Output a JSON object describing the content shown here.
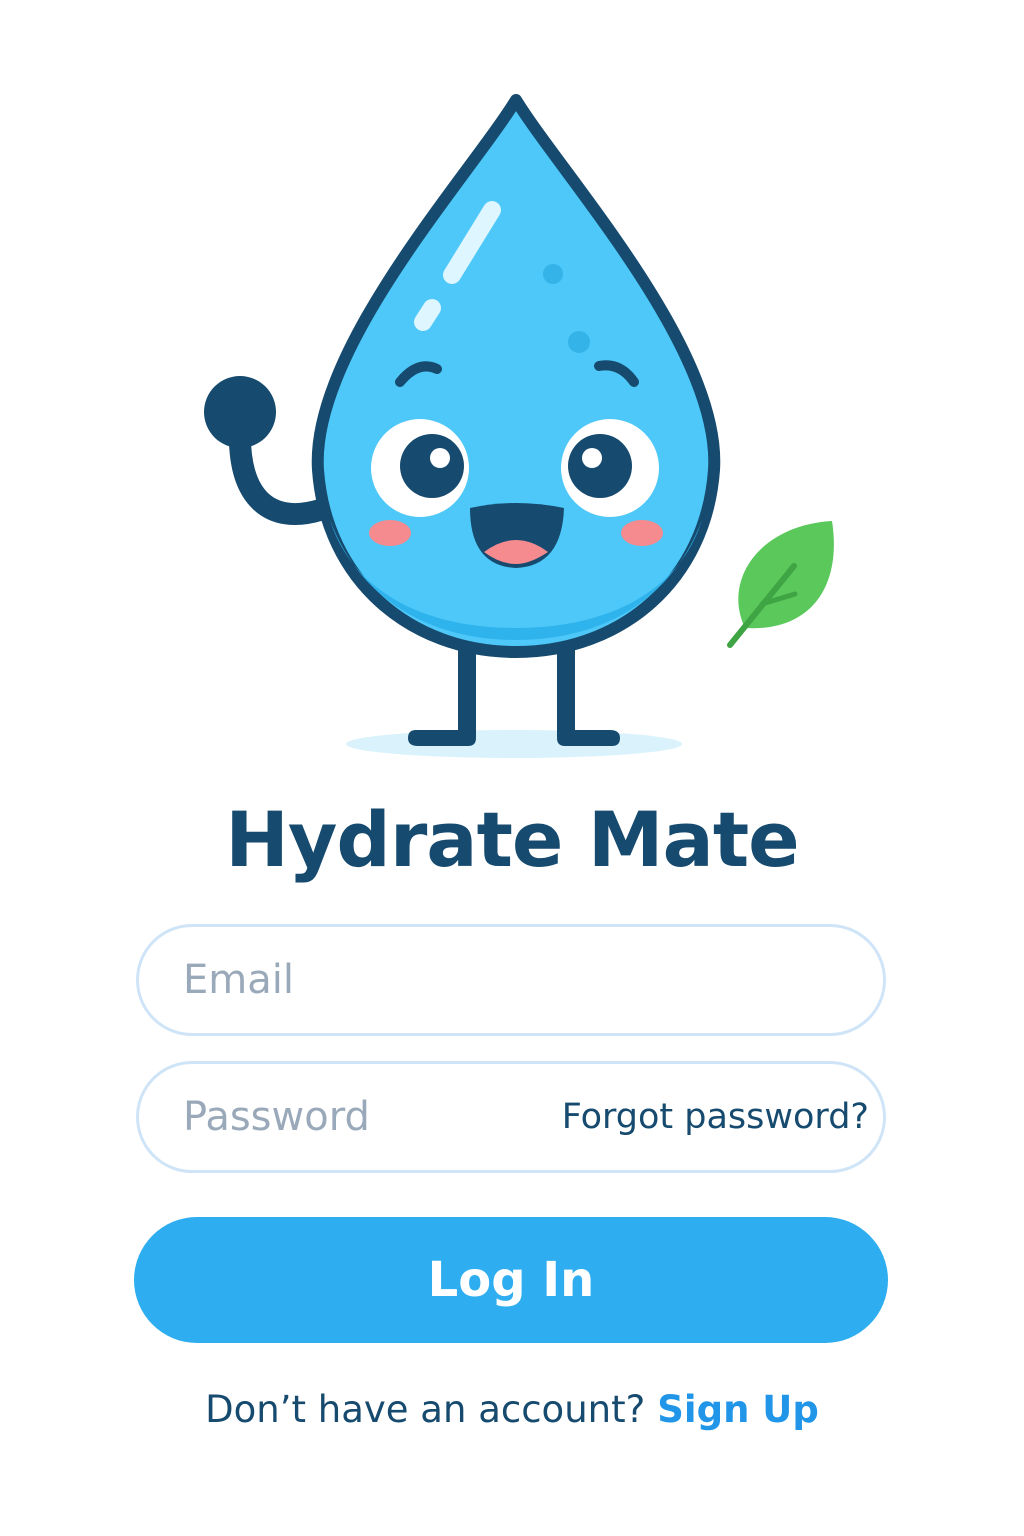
{
  "app": {
    "title": "Hydrate Mate"
  },
  "form": {
    "email_placeholder": "Email",
    "email_value": "",
    "password_placeholder": "Password",
    "password_value": "",
    "forgot_password_label": "Forgot password?",
    "login_label": "Log In"
  },
  "footer": {
    "prompt": "Don’t have an account?",
    "signup_label": "Sign Up"
  },
  "icons": {
    "mascot": "water-drop-mascot-icon",
    "leaf": "leaf-icon"
  },
  "colors": {
    "primary": "#2eaef0",
    "title": "#164a6e",
    "link": "#2196e8",
    "field_border": "#cfe5f7",
    "drop": "#4dc8f8",
    "leaf": "#5ac85a"
  }
}
